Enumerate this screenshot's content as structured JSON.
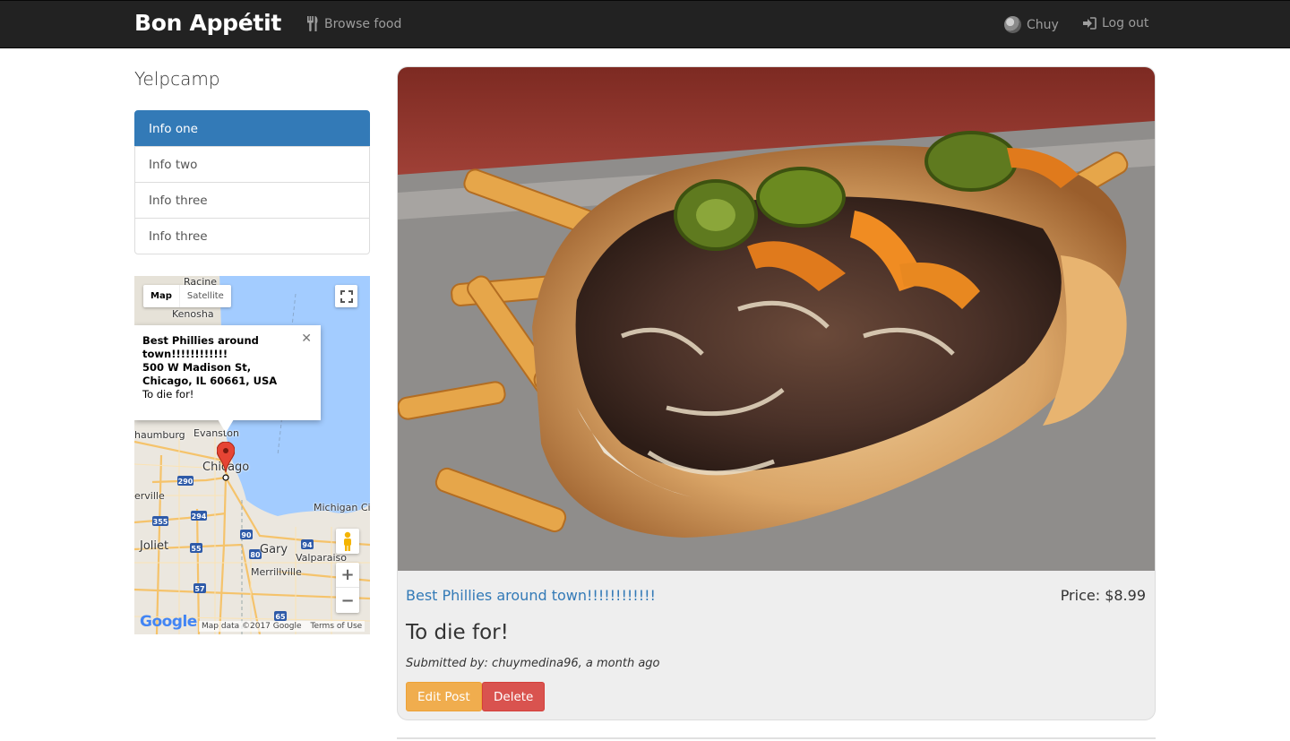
{
  "navbar": {
    "brand": "Bon Appétit",
    "browse_label": "Browse food",
    "user_label": "Chuy",
    "logout_label": "Log out"
  },
  "sidebar": {
    "title": "Yelpcamp",
    "items": [
      {
        "label": "Info one",
        "active": true
      },
      {
        "label": "Info two",
        "active": false
      },
      {
        "label": "Info three",
        "active": false
      },
      {
        "label": "Info three",
        "active": false
      }
    ]
  },
  "map": {
    "type_map": "Map",
    "type_satellite": "Satellite",
    "info_title": "Best Phillies around town!!!!!!!!!!!!",
    "info_address_1": "500 W Madison St,",
    "info_address_2": "Chicago, IL 60661, USA",
    "info_desc": "To die for!",
    "attribution": "Map data ©2017 Google",
    "terms": "Terms of Use",
    "logo": "Google",
    "cities": {
      "racine": "Racine",
      "kenosha": "Kenosha",
      "evanston": "Evanston",
      "schaumburg": "haumburg",
      "chicago": "Chicago",
      "naperville": "erville",
      "michigan_city": "Michigan Ci",
      "joliet": "Joliet",
      "gary": "Gary",
      "valparaiso": "Valparaiso",
      "merrillville": "Merrillville"
    },
    "shields": [
      "290",
      "355",
      "294",
      "90",
      "55",
      "80",
      "94",
      "57",
      "65"
    ]
  },
  "post": {
    "title": "Best Phillies around town!!!!!!!!!!!!",
    "price": "Price: $8.99",
    "description": "To die for!",
    "submitted": "Submitted by: chuymedina96, a month ago",
    "edit_label": "Edit Post",
    "delete_label": "Delete"
  },
  "colors": {
    "navbar": "#222222",
    "primary": "#337ab7",
    "warning": "#f0ad4e",
    "danger": "#d9534f",
    "water": "#a3ccff"
  }
}
